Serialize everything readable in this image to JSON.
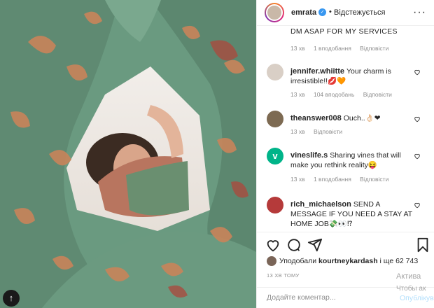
{
  "post": {
    "author": "emrata",
    "follow_status": "Відстежується",
    "more_icon": "more-icon",
    "caption_fragment": "DM ASAP FOR MY SERVICES"
  },
  "caption_meta": {
    "time": "13 хв",
    "likes": "1 вподобання",
    "reply": "Відповісти"
  },
  "comments": [
    {
      "user": "jennifer.whiitte",
      "text": "Your charm is irresistible!!💋🧡",
      "time": "13 хв",
      "likes": "104 вподобань",
      "reply": "Відповісти",
      "avatar_color": "#d9cfc6"
    },
    {
      "user": "theanswer008",
      "text": "Ouch..👌🏻❤",
      "time": "13 хв",
      "likes": "",
      "reply": "Відповісти",
      "avatar_color": "#7d6a52"
    },
    {
      "user": "vineslife.s",
      "text": "Sharing vines that will make you rethink reality😝",
      "time": "13 хв",
      "likes": "1 вподобання",
      "reply": "Відповісти",
      "avatar_color": "#00b489"
    },
    {
      "user": "rich_michaelson",
      "text": "SEND A MESSAGE IF YOU NEED A STAY AT HOME JOB💸👀⁉",
      "time": "",
      "likes": "",
      "reply": "",
      "avatar_color": "#b53a3a"
    }
  ],
  "likes": {
    "prefix": "Уподобали",
    "user": "kourtneykardash",
    "suffix": "і ще 62 743"
  },
  "timestamp": "13 ХВ ТОМУ",
  "add_comment": {
    "placeholder": "Додайте коментар...",
    "post_label": "Опублікувати"
  },
  "windows_watermark": {
    "line1": "Актива",
    "line2": "Чтобы ак"
  },
  "colors": {
    "accent": "#3897f0",
    "muted": "#8e8e8e",
    "photo_green": "#5f8a72",
    "photo_blobs": "#c9845a"
  }
}
